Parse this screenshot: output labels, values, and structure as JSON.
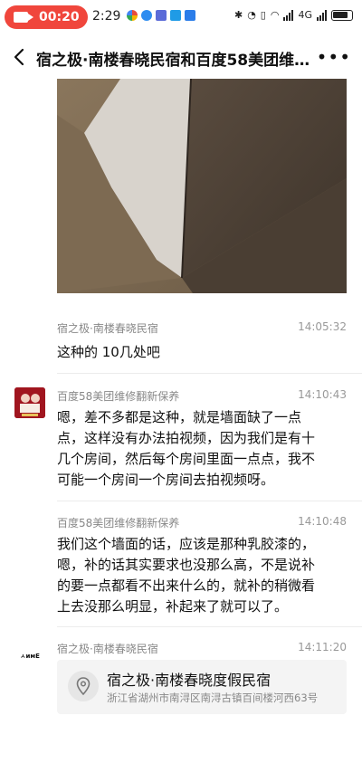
{
  "status_bar": {
    "record_time": "00:20",
    "clock": "2:29",
    "network_label": "4G"
  },
  "header": {
    "title": "宿之极·南楼春晓民宿和百度58美团维修…",
    "back_icon": "chevron-left-icon",
    "more_icon": "more-dots-icon"
  },
  "messages": [
    {
      "sender": "宿之极·南楼春晓民宿",
      "time": "14:05:32",
      "text": "这种的 10几处吧"
    },
    {
      "sender": "百度58美团维修翻新保养",
      "time": "14:10:43",
      "lines": [
        "嗯，差不多都是这种，就是墙面缺了一点",
        "点，这样没有办法拍视频，因为我们是有十",
        "几个房间，然后每个房间里面一点点，我不",
        "可能一个房间一个房间去拍视频呀。"
      ]
    },
    {
      "sender": "百度58美团维修翻新保养",
      "time": "14:10:48",
      "lines": [
        "我们这个墙面的话，应该是那种乳胶漆的，",
        "嗯，补的话其实要求也没那么高，不是说补",
        "的要一点都看不出来什么的，就补的稍微看",
        "上去没那么明显，补起来了就可以了。"
      ]
    },
    {
      "sender": "宿之极·南楼春晓民宿",
      "time": "14:11:20"
    }
  ],
  "location": {
    "name": "宿之极·南楼春晓度假民宿",
    "address": "浙江省湖州市南浔区南浔古镇百间楼河西63号"
  },
  "avatar2_text": "ㅅᴎᴍE",
  "colors": {
    "record_pill": "#f0463c",
    "avatar1_bg": "#a0151f"
  }
}
